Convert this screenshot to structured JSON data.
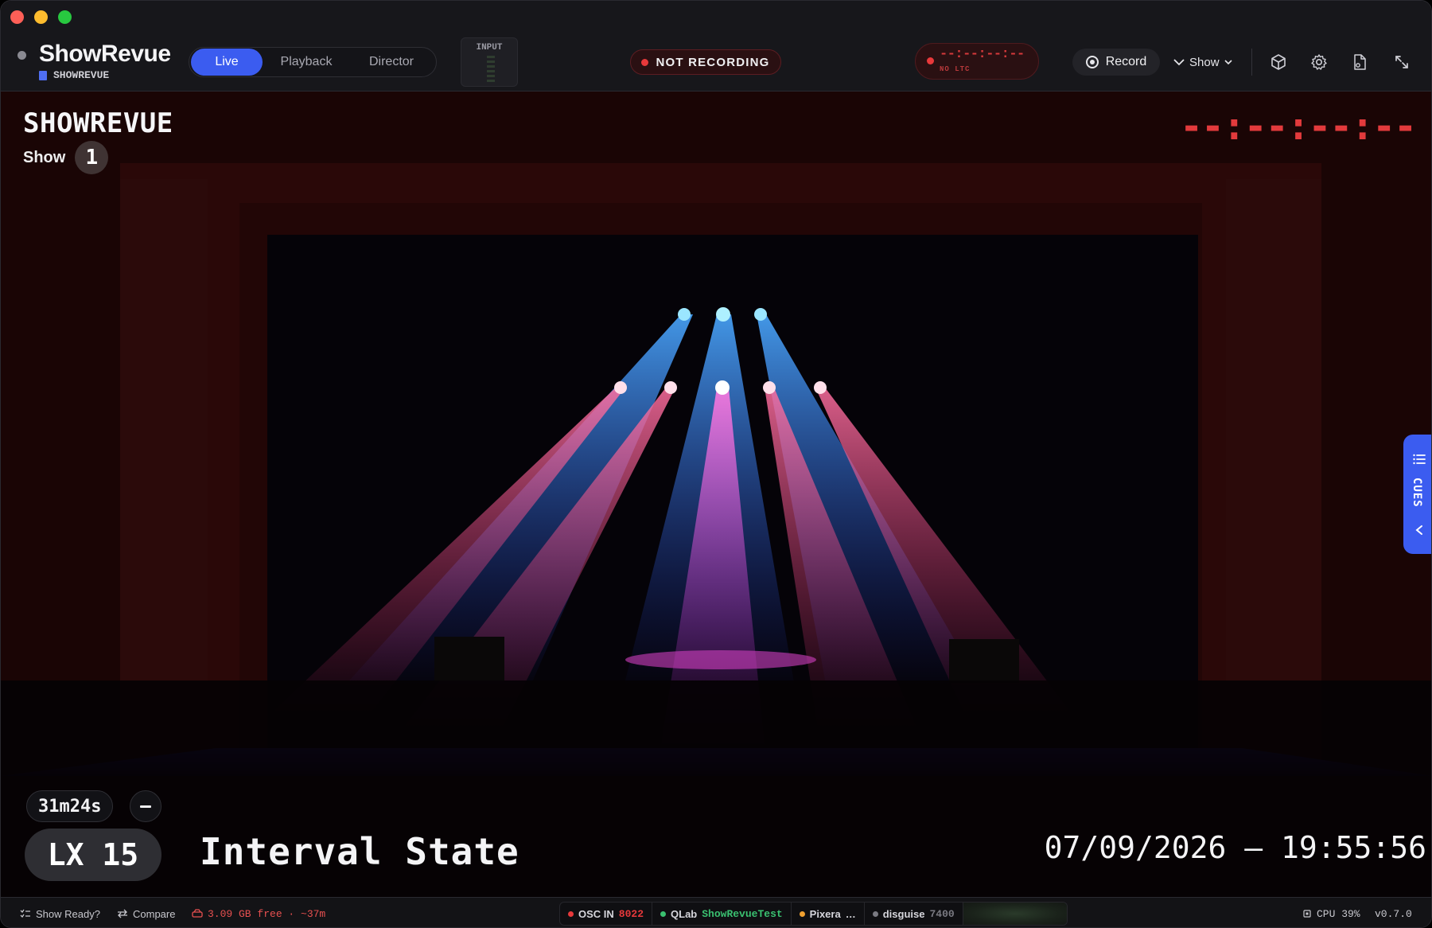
{
  "app": {
    "name": "ShowRevue",
    "document": "SHOWREVUE"
  },
  "modes": {
    "tabs": [
      "Live",
      "Playback",
      "Director"
    ],
    "active": "Live"
  },
  "input_meter": {
    "label": "INPUT"
  },
  "recording": {
    "status": "NOT RECORDING",
    "timecode": "--:--:--:--",
    "timecode_source": "NO LTC",
    "record_label": "Record",
    "show_menu_label": "Show"
  },
  "toolbar_icons": [
    "cube-icon",
    "gear-icon",
    "export-icon",
    "fullscreen-icon"
  ],
  "overlay": {
    "title": "SHOWREVUE",
    "show_label": "Show",
    "show_number": "1",
    "timecode": "--:--:--:--",
    "elapsed": "31m24s",
    "cue_id": "LX 15",
    "cue_name": "Interval State",
    "datetime": "07/09/2026 – 19:55:56"
  },
  "cues_tab": {
    "label": "CUES"
  },
  "statusbar": {
    "show_ready": "Show Ready?",
    "compare": "Compare",
    "disk": "3.09 GB free · ~37m",
    "integrations": [
      {
        "name": "OSC IN",
        "detail": "8022",
        "color": "#e8393b"
      },
      {
        "name": "QLab",
        "detail": "ShowRevueTest",
        "color": "#3ac070"
      },
      {
        "name": "Pixera",
        "detail": "…",
        "color": "#f0a030"
      },
      {
        "name": "disguise",
        "detail": "7400",
        "color": "#7a7a82"
      }
    ],
    "cpu": "CPU 39%",
    "version": "v0.7.0"
  },
  "colors": {
    "accent": "#3b5cf0",
    "recording_red": "#e8393b",
    "window_bg": "#17171b"
  }
}
